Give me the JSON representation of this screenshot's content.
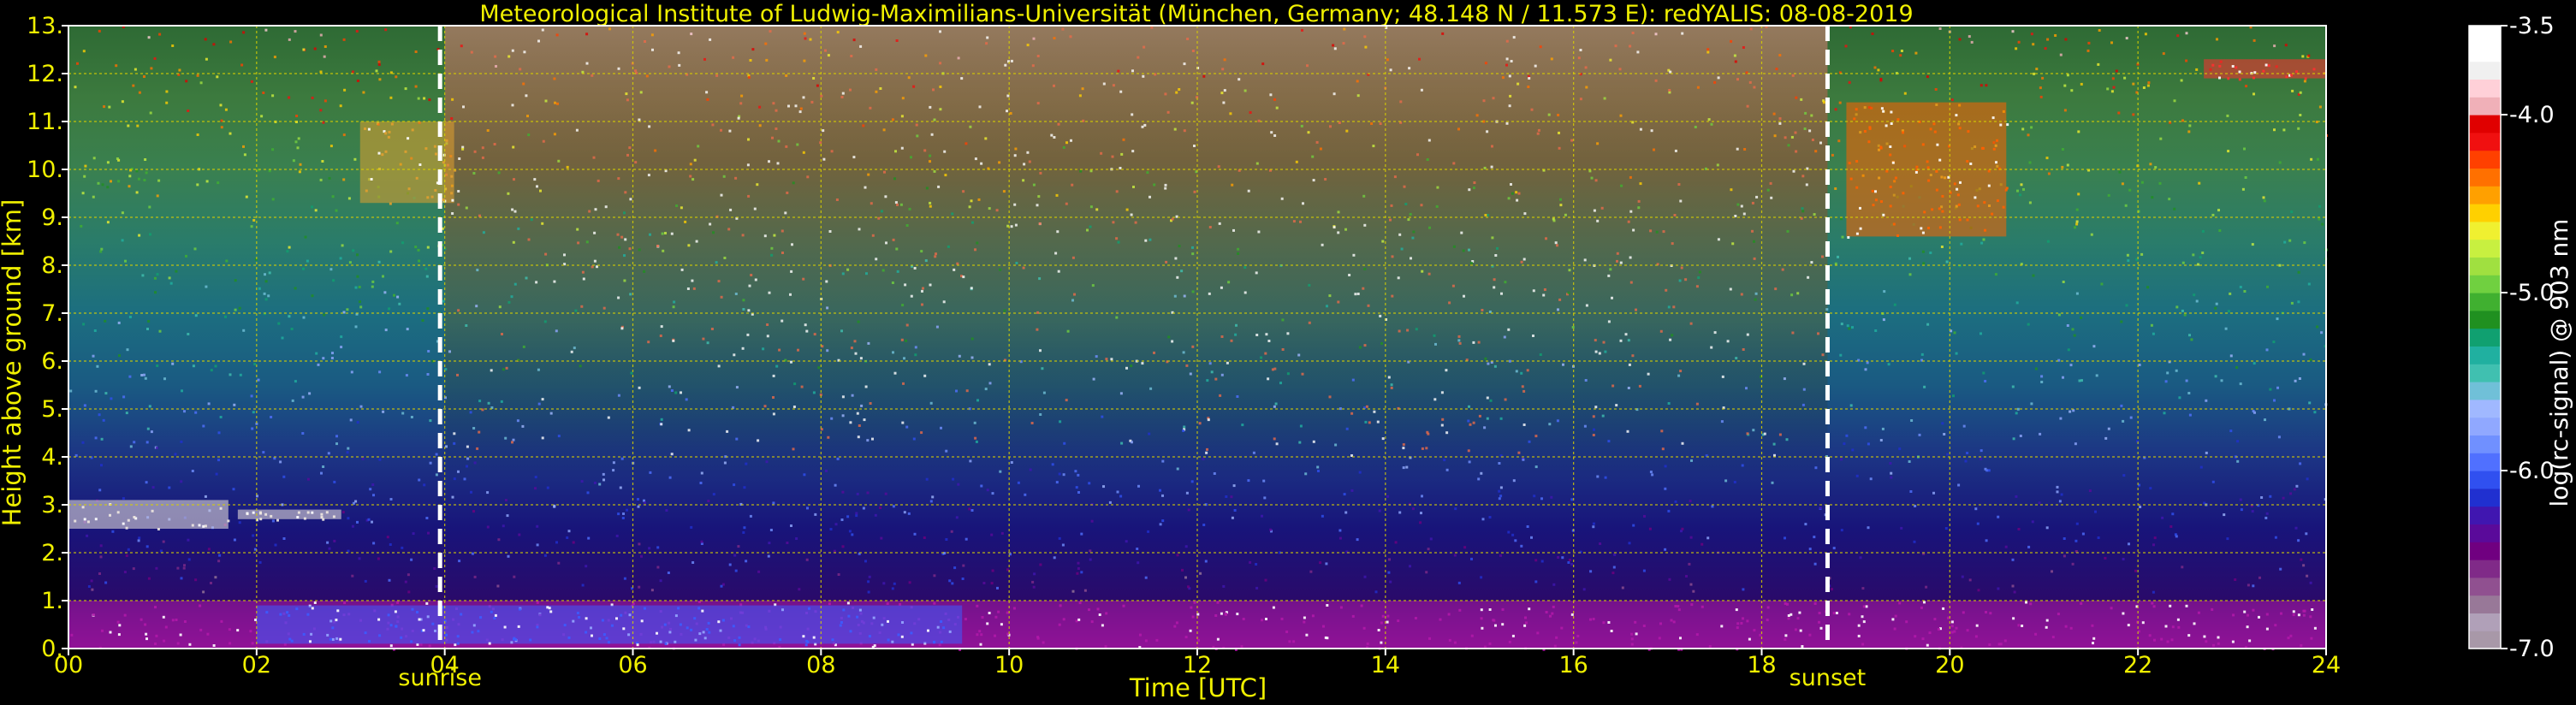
{
  "chart_data": {
    "type": "heatmap",
    "title": "Meteorological Institute of Ludwig-Maximilians-Universität (München, Germany; 48.148 N / 11.573 E):    redYALIS: 08-08-2019",
    "xlabel": "Time [UTC]",
    "ylabel": "Height above ground [km]",
    "xlim": [
      0,
      24
    ],
    "ylim": [
      0,
      13
    ],
    "x_ticks": [
      "00",
      "02",
      "04",
      "06",
      "08",
      "10",
      "12",
      "14",
      "16",
      "18",
      "20",
      "22",
      "24"
    ],
    "y_ticks": [
      "0.",
      "1.",
      "2.",
      "3.",
      "4.",
      "5.",
      "6.",
      "7.",
      "8.",
      "9.",
      "10.",
      "11.",
      "12.",
      "13."
    ],
    "grid": true,
    "events": [
      {
        "label": "sunrise",
        "time": 3.95
      },
      {
        "label": "sunset",
        "time": 18.7
      }
    ],
    "colorbar": {
      "label": "log(rc-signal) @ 903 nm",
      "range": [
        -7.0,
        -3.5
      ],
      "ticks": [
        "-3.5",
        "-4.0",
        "-5.0",
        "-6.0",
        "-7.0"
      ],
      "colors": [
        "#a898a8",
        "#b0a0b8",
        "#987898",
        "#905090",
        "#802a88",
        "#700080",
        "#5a0a9a",
        "#4016b0",
        "#2030d0",
        "#3050f0",
        "#5070ff",
        "#7090ff",
        "#90a8ff",
        "#a0b8ff",
        "#70c0d8",
        "#40c0b0",
        "#20b0a0",
        "#10a070",
        "#209020",
        "#40b030",
        "#70d040",
        "#a0e040",
        "#c8f040",
        "#f0f030",
        "#ffd000",
        "#ffa000",
        "#ff7000",
        "#ff4000",
        "#f01010",
        "#e00000",
        "#f0b0b8",
        "#ffd0d8",
        "#f0f0f0",
        "#ffffff",
        "#ffffff"
      ]
    },
    "background_profile": [
      {
        "height": 0,
        "color": "#6a0a82"
      },
      {
        "height": 1,
        "color": "#2a0a6a"
      },
      {
        "height": 2.5,
        "color": "#18147a"
      },
      {
        "height": 4,
        "color": "#1c3484"
      },
      {
        "height": 5.5,
        "color": "#1a5a82"
      },
      {
        "height": 7,
        "color": "#1c6e80"
      },
      {
        "height": 8.5,
        "color": "#2a7c6a"
      },
      {
        "height": 10,
        "color": "#3a8050"
      },
      {
        "height": 11.5,
        "color": "#3c7a3e"
      },
      {
        "height": 13,
        "color": "#2e6a34"
      }
    ],
    "noisy_period": {
      "start": 4.0,
      "end": 18.7
    },
    "features": [
      {
        "name": "boundary-layer-aerosol",
        "t0": 0,
        "t1": 24,
        "h0": 0,
        "h1": 1.0,
        "color": "#b01aa8"
      },
      {
        "name": "morning-low-cloud",
        "t0": 2.0,
        "t1": 9.5,
        "h0": 0.1,
        "h1": 0.9,
        "color": "#3c5cff"
      },
      {
        "name": "night-cloud-layer",
        "t0": 0,
        "t1": 1.7,
        "h0": 2.5,
        "h1": 3.1,
        "color": "#f0e8e0"
      },
      {
        "name": "cloud-layer-2",
        "t0": 1.8,
        "t1": 2.9,
        "h0": 2.7,
        "h1": 2.9,
        "color": "#f0e8e0"
      },
      {
        "name": "cirrus-morning",
        "t0": 3.1,
        "t1": 4.1,
        "h0": 9.3,
        "h1": 11.0,
        "color": "#e0a030"
      },
      {
        "name": "cirrus-evening",
        "t0": 18.9,
        "t1": 20.6,
        "h0": 8.6,
        "h1": 11.4,
        "color": "#ff6000"
      },
      {
        "name": "high-cirrus",
        "t0": 22.7,
        "t1": 24,
        "h0": 11.9,
        "h1": 12.3,
        "color": "#ff3030"
      }
    ]
  }
}
